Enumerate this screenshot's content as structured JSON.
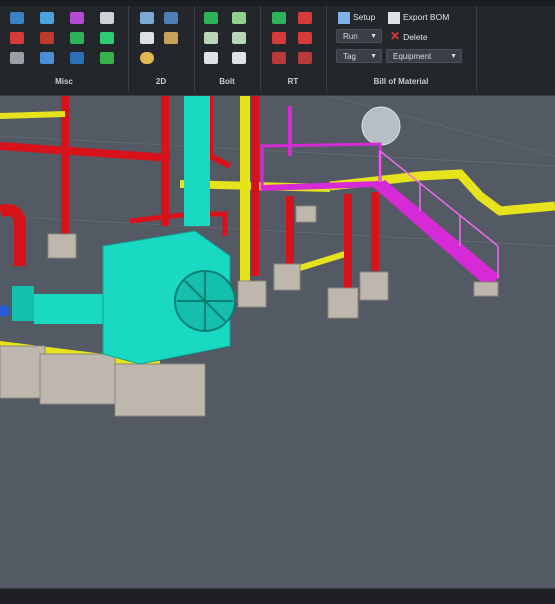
{
  "ribbon": {
    "panels": [
      {
        "id": "misc",
        "label": "Misc"
      },
      {
        "id": "2d",
        "label": "2D"
      },
      {
        "id": "bolt",
        "label": "Bolt"
      },
      {
        "id": "rt",
        "label": "RT"
      },
      {
        "id": "bom",
        "label": "Bill of Material"
      }
    ],
    "bom": {
      "setup_label": "Setup",
      "export_label": "Export BOM",
      "run_label": "Run",
      "delete_label": "Delete",
      "tag_label": "Tag",
      "equipment_label": "Equipment"
    }
  },
  "colors": {
    "ribbon_bg": "#23262b",
    "viewport_bg": "#535a63",
    "pipe_red": "#d8121b",
    "structure_yellow": "#e6e21c",
    "stair_magenta": "#d62ad6",
    "equipment_cyan": "#19d9c3",
    "concrete": "#bdb7ae"
  },
  "icons": [
    "grid-icon",
    "pipe-icon",
    "export-icon",
    "delete-icon",
    "settings-icon"
  ]
}
